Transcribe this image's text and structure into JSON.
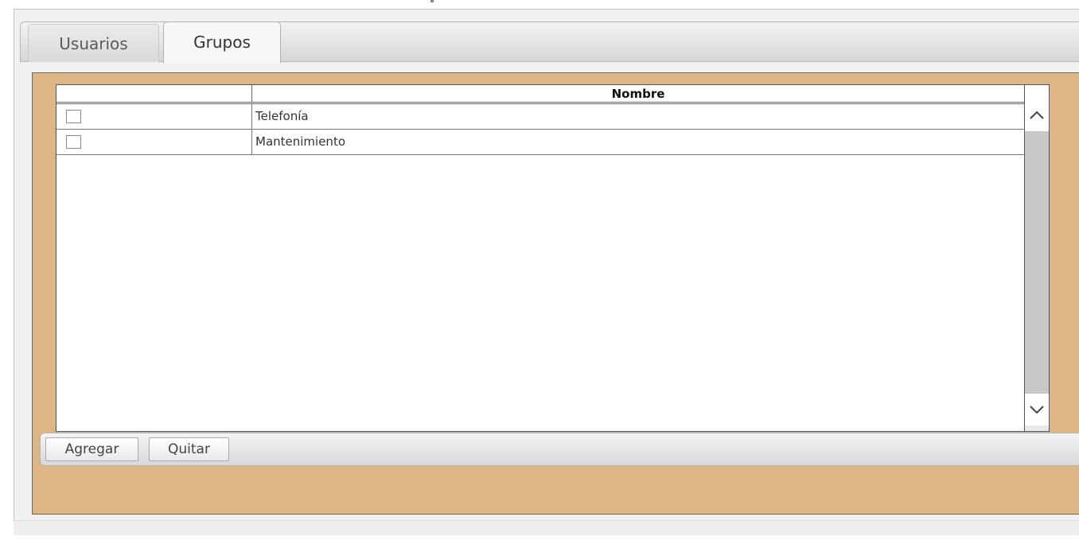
{
  "tabs": [
    {
      "label": "Usuarios",
      "active": false
    },
    {
      "label": "Grupos",
      "active": true
    }
  ],
  "grid": {
    "columns": [
      {
        "label": ""
      },
      {
        "label": "Nombre"
      }
    ],
    "rows": [
      {
        "checked": false,
        "name": "Telefonía"
      },
      {
        "checked": false,
        "name": "Mantenimiento"
      }
    ]
  },
  "buttons": {
    "add_label": "Agregar",
    "remove_label": "Quitar"
  },
  "colors": {
    "panel_bg": "#deb584",
    "scroll_track": "#c8c8c8"
  },
  "icons": {
    "scroll_up": "chevron-up-icon",
    "scroll_down": "chevron-down-icon"
  }
}
